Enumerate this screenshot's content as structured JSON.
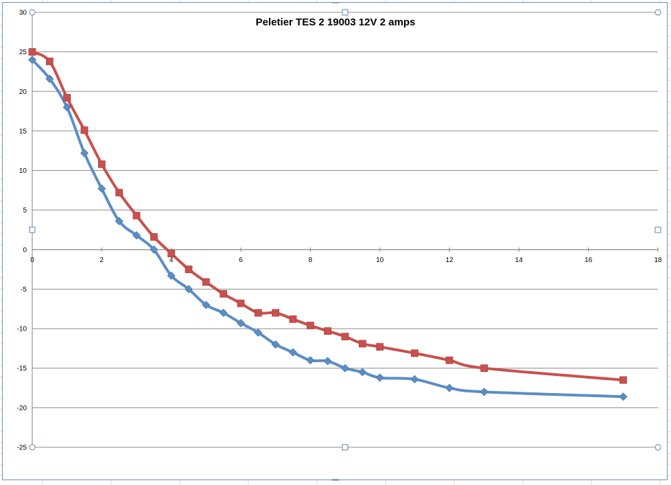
{
  "colors": {
    "sheet_grid": "#cfe0ef",
    "selection_border": "#6f8fb5",
    "gridline": "#8c8c8c",
    "axis": "#7f7f7f",
    "series_blue": "#5b8ec4",
    "series_red": "#c9504d"
  },
  "chart_data": {
    "type": "scatter",
    "title": "Peletier TES 2 19003 12V 2 amps",
    "xlabel": "",
    "ylabel": "",
    "xlim": [
      0,
      18
    ],
    "ylim": [
      -25,
      30
    ],
    "x_ticks": [
      "0",
      "2",
      "4",
      "6",
      "8",
      "10",
      "12",
      "14",
      "16",
      "18"
    ],
    "y_ticks": [
      "30",
      "25",
      "20",
      "15",
      "10",
      "5",
      "0",
      "-5",
      "-10",
      "-15",
      "-20",
      "-25"
    ],
    "grid": "horizontal",
    "legend": "none",
    "series": [
      {
        "color": "#5b8ec4",
        "marker": "diamond",
        "x": [
          0,
          0.5,
          1,
          1.5,
          2,
          2.5,
          3,
          3.5,
          4,
          4.5,
          5,
          5.5,
          6,
          6.5,
          7,
          7.5,
          8,
          8.5,
          9,
          9.5,
          10,
          11,
          12,
          13,
          17
        ],
        "y": [
          24,
          21.6,
          18,
          12.2,
          7.7,
          3.6,
          1.8,
          0,
          -3.3,
          -5,
          -7,
          -8,
          -9.3,
          -10.5,
          -12,
          -13,
          -14,
          -14.1,
          -15,
          -15.5,
          -16.2,
          -16.4,
          -17.5,
          -18,
          -18.6
        ]
      },
      {
        "color": "#c9504d",
        "marker": "square",
        "x": [
          0,
          0.5,
          1,
          1.5,
          2,
          2.5,
          3,
          3.5,
          4,
          4.5,
          5,
          5.5,
          6,
          6.5,
          7,
          7.5,
          8,
          8.5,
          9,
          9.5,
          10,
          11,
          12,
          13,
          17
        ],
        "y": [
          25,
          23.8,
          19.2,
          15.1,
          10.8,
          7.2,
          4.3,
          1.6,
          -0.5,
          -2.5,
          -4.1,
          -5.6,
          -6.8,
          -8,
          -8,
          -8.8,
          -9.6,
          -10.3,
          -11,
          -11.9,
          -12.3,
          -13.1,
          -14,
          -15,
          -16.5
        ]
      }
    ]
  }
}
